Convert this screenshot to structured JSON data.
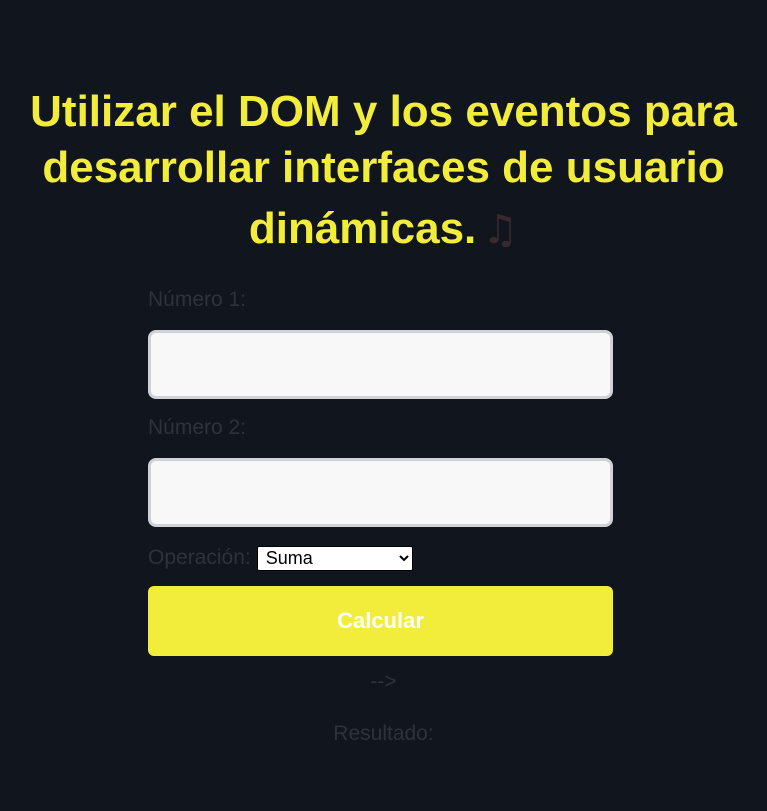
{
  "header": {
    "title_line1": "Utilizar el DOM y los eventos para",
    "title_line2": "desarrollar interfaces de usuario",
    "title_line3": "dinámicas.",
    "title_icon": "music-notes-icon"
  },
  "form": {
    "number1_label": "Número 1:",
    "number1_value": "",
    "number2_label": "Número 2:",
    "number2_value": "",
    "operation_label": "Operación:",
    "operation_selected": "Suma",
    "calculate_label": "Calcular"
  },
  "stray_text": "-->",
  "result": {
    "label": "Resultado:"
  },
  "colors": {
    "background": "#11151e",
    "accent": "#f2ec3b",
    "muted_text": "#2e323a"
  }
}
